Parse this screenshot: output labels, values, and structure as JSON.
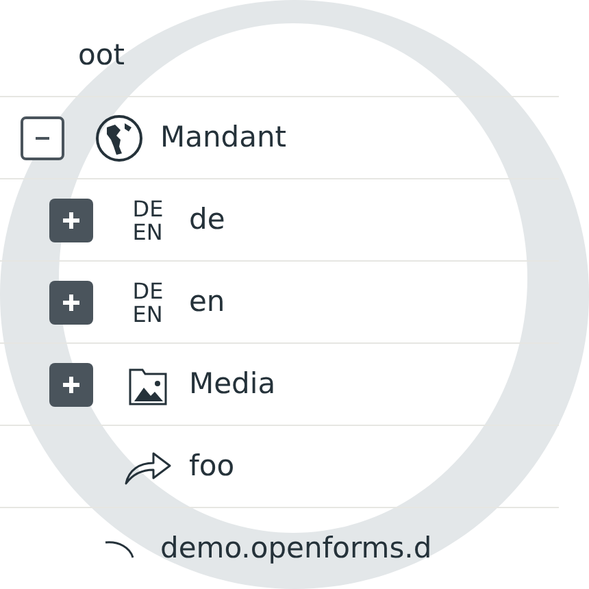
{
  "tree": [
    {
      "label": "oot",
      "kind": "root",
      "children": [
        {
          "label": "Mandant",
          "kind": "globe",
          "expanded": true,
          "children": [
            {
              "label": "de",
              "kind": "language",
              "expanded": false,
              "icon_text": [
                "DE",
                "EN"
              ]
            },
            {
              "label": "en",
              "kind": "language",
              "expanded": false,
              "icon_text": [
                "DE",
                "EN"
              ]
            },
            {
              "label": "Media",
              "kind": "media",
              "expanded": false
            },
            {
              "label": "foo",
              "kind": "link"
            }
          ]
        },
        {
          "label": "demo.openforms.d",
          "kind": "site"
        }
      ]
    }
  ]
}
